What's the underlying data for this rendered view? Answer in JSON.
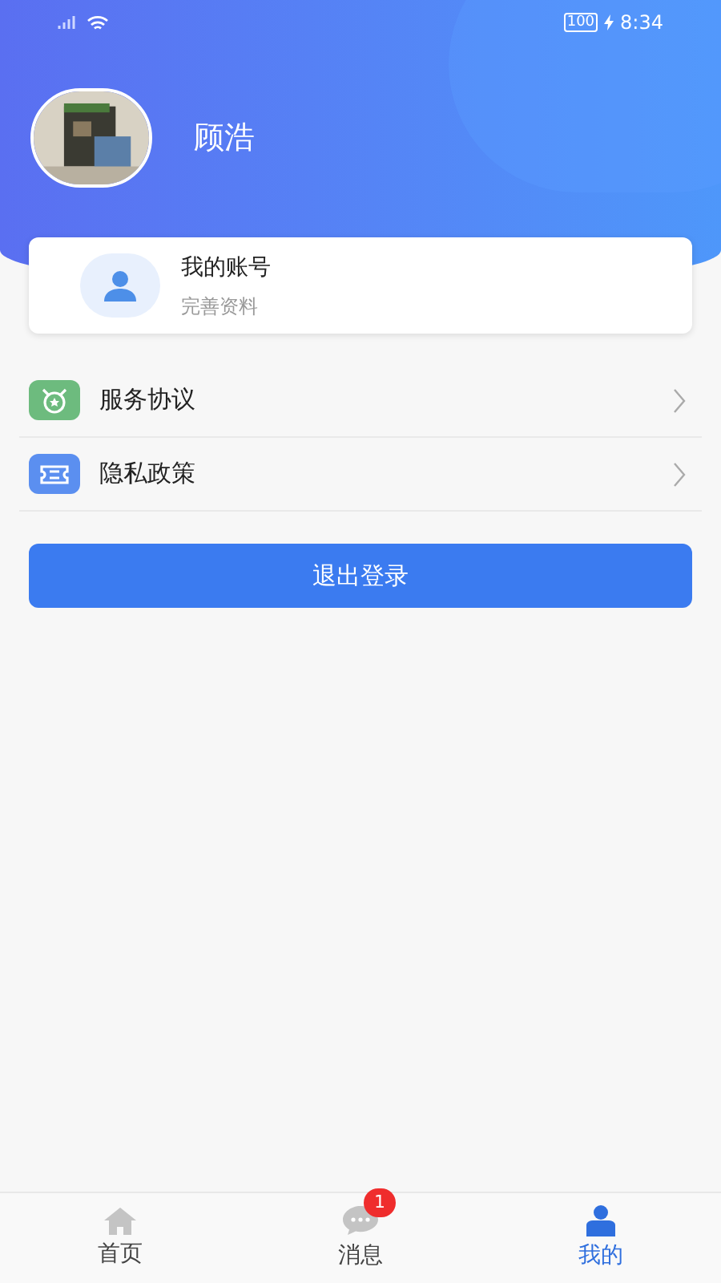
{
  "status_bar": {
    "battery": "100",
    "time": "8:34"
  },
  "profile": {
    "name": "顾浩"
  },
  "account_card": {
    "title": "我的账号",
    "subtitle": "完善资料"
  },
  "menu": [
    {
      "label": "服务协议",
      "kind": "agreement",
      "color": "#6dbb7e"
    },
    {
      "label": "隐私政策",
      "kind": "privacy",
      "color": "#5b8ff0"
    }
  ],
  "logout_button": "退出登录",
  "tabs": [
    {
      "label": "首页",
      "kind": "home",
      "selected": false
    },
    {
      "label": "消息",
      "kind": "messages",
      "selected": false,
      "badge": "1"
    },
    {
      "label": "我的",
      "kind": "mine",
      "selected": true
    }
  ]
}
